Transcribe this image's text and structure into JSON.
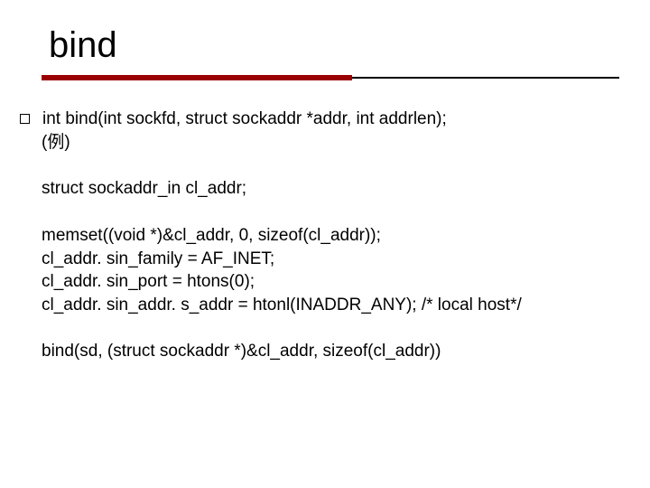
{
  "title": "bind",
  "bullet": {
    "line1": "int bind(int sockfd, struct sockaddr *addr, int addrlen);",
    "line2": "(例)"
  },
  "para1": "struct sockaddr_in cl_addr;",
  "para2": {
    "l1": "memset((void *)&cl_addr, 0, sizeof(cl_addr));",
    "l2": "cl_addr. sin_family = AF_INET;",
    "l3": "cl_addr. sin_port = htons(0);",
    "l4": "cl_addr. sin_addr. s_addr = htonl(INADDR_ANY);  /* local host*/"
  },
  "para3": "bind(sd, (struct sockaddr *)&cl_addr, sizeof(cl_addr))"
}
